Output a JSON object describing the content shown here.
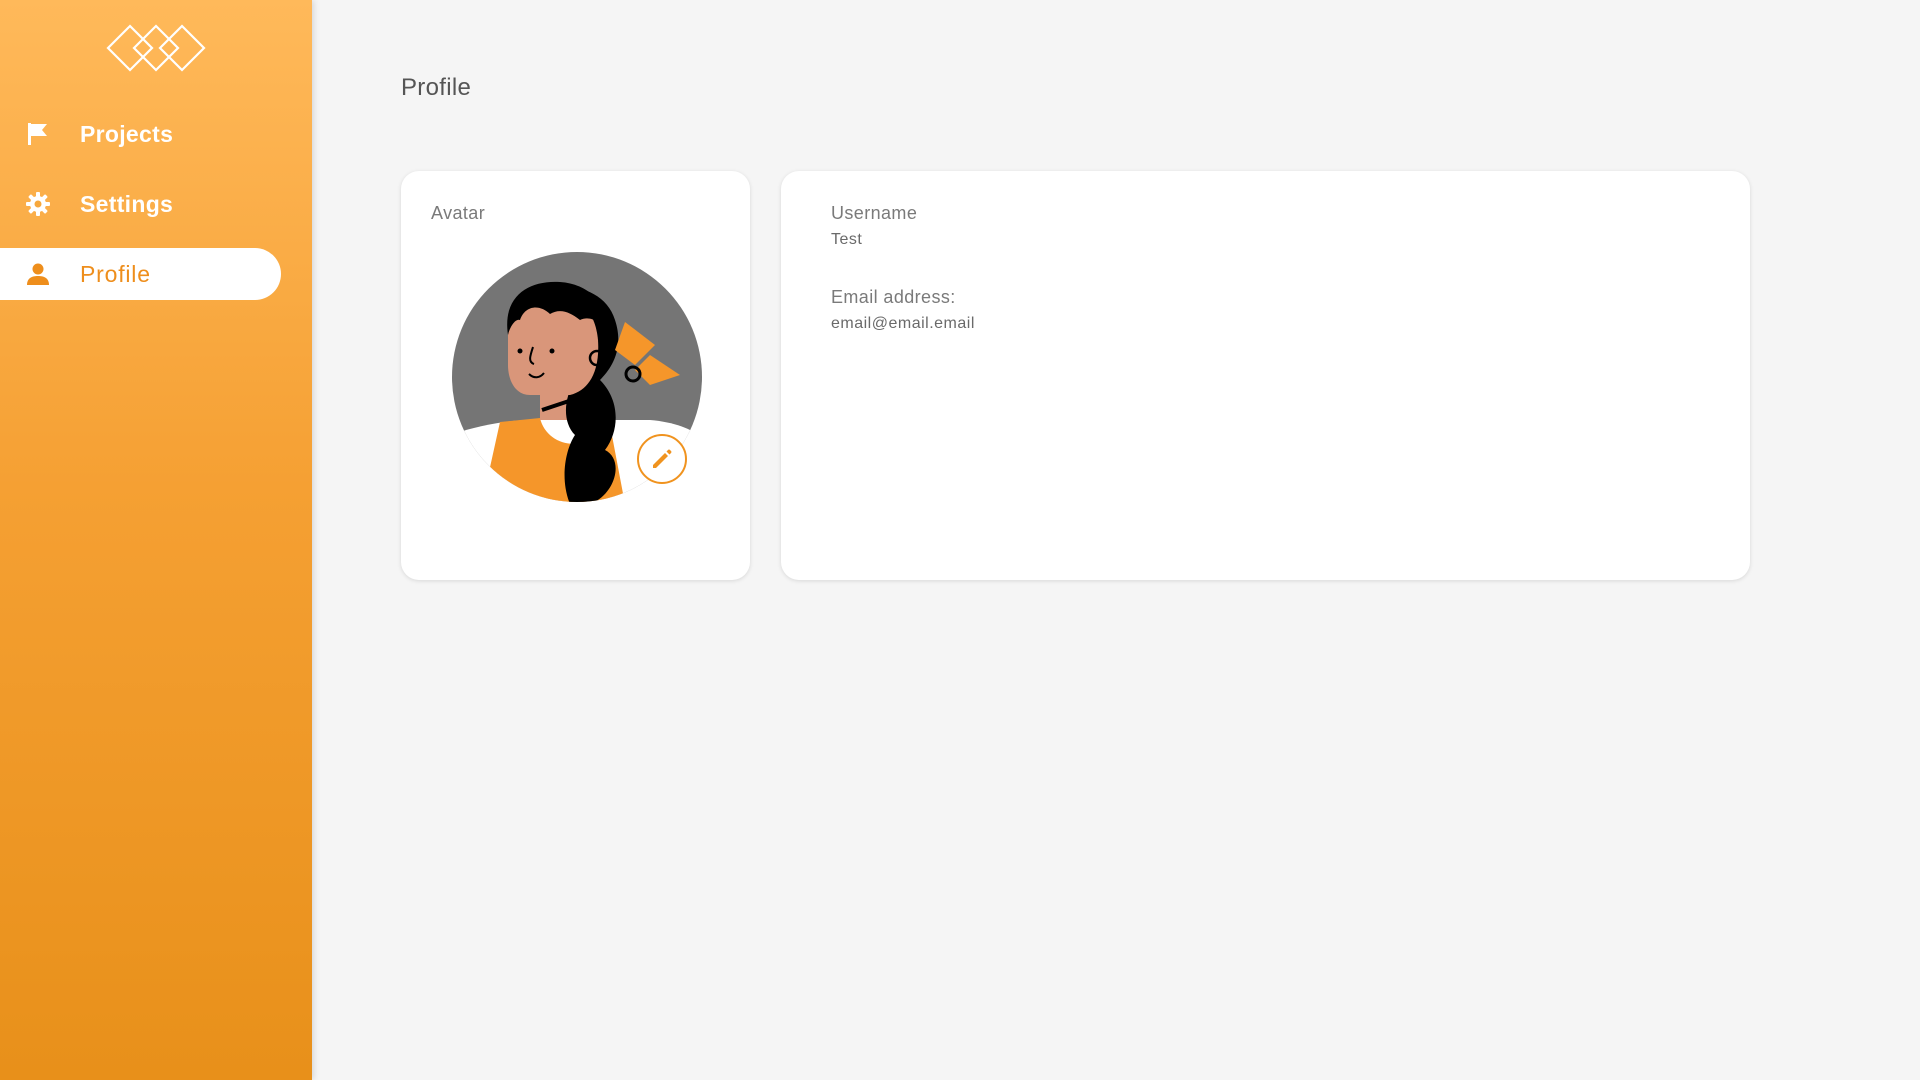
{
  "sidebar": {
    "logo_icon": "triple-diamond-logo-icon",
    "items": [
      {
        "label": "Projects",
        "icon": "flag-icon",
        "active": false
      },
      {
        "label": "Settings",
        "icon": "gear-icon",
        "active": false
      },
      {
        "label": "Profile",
        "icon": "person-icon",
        "active": true
      }
    ]
  },
  "page": {
    "title": "Profile"
  },
  "avatar_card": {
    "label": "Avatar",
    "edit_icon": "pencil-icon"
  },
  "info_card": {
    "username_label": "Username",
    "username_value": "Test",
    "email_label": "Email address:",
    "email_value": "email@email.email"
  },
  "colors": {
    "accent": "#f0931f",
    "sidebar_top": "#ffb95a",
    "sidebar_bottom": "#e8901a",
    "background": "#f5f5f5",
    "avatar_bg": "#757575"
  }
}
